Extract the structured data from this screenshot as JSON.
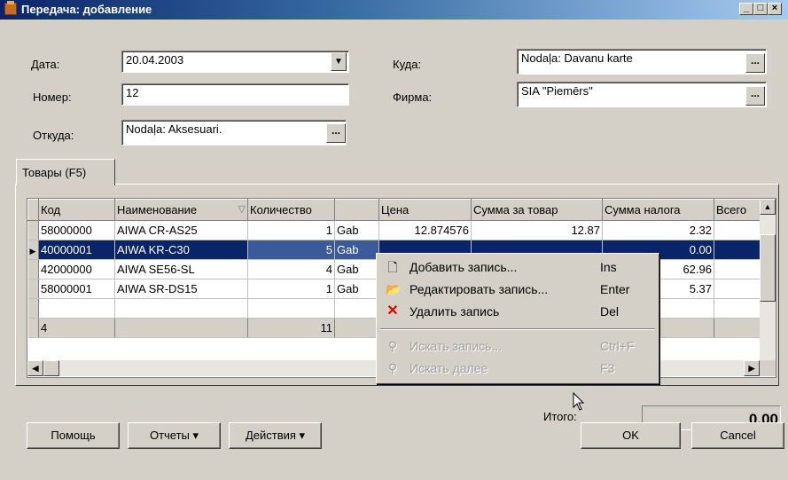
{
  "window": {
    "title": "Передача: добавление",
    "minimize": "_",
    "maximize": "□",
    "close": "×"
  },
  "form": {
    "date_label": "Дата:",
    "date_value": "20.04.2003",
    "number_label": "Номер:",
    "number_value": "12",
    "from_label": "Откуда:",
    "from_value": "Nodaļa: Aksesuari.",
    "to_label": "Куда:",
    "to_value": "Nodaļa: Davanu karte",
    "firm_label": "Фирма:",
    "firm_value": "SIA \"Piemērs\"",
    "ellipsis": "...",
    "dropdown": "▼"
  },
  "tab": {
    "label": "Товары (F5)"
  },
  "grid": {
    "columns": [
      "Код",
      "Наименование",
      "Количество",
      "",
      "Цена",
      "Сумма за товар",
      "Сумма налога",
      "Всего"
    ],
    "sort_glyph": "▽",
    "rows": [
      {
        "code": "58000000",
        "name": "AIWA CR-AS25",
        "qty": "1",
        "unit": "Gab",
        "price": "12.874576",
        "sum": "12.87",
        "tax": "2.32",
        "selected": false
      },
      {
        "code": "40000001",
        "name": "AIWA KR-C30",
        "qty": "5",
        "unit": "Gab",
        "price": "",
        "sum": "",
        "tax": "0.00",
        "selected": true
      },
      {
        "code": "42000000",
        "name": "AIWA SE56-SL",
        "qty": "4",
        "unit": "Gab",
        "price": "",
        "sum": "",
        "tax": "62.96",
        "selected": false
      },
      {
        "code": "58000001",
        "name": "AIWA SR-DS15",
        "qty": "1",
        "unit": "Gab",
        "price": "",
        "sum": "",
        "tax": "5.37",
        "selected": false
      }
    ],
    "footer": {
      "count": "4",
      "qty_total": "11"
    }
  },
  "context_menu": {
    "items": [
      {
        "label": "Добавить запись...",
        "shortcut": "Ins",
        "icon": "new-document-icon",
        "glyph": "🗋",
        "enabled": true
      },
      {
        "label": "Редактировать запись...",
        "shortcut": "Enter",
        "icon": "open-folder-icon",
        "glyph": "📂",
        "enabled": true
      },
      {
        "label": "Удалить запись",
        "shortcut": "Del",
        "icon": "delete-x-icon",
        "glyph": "✕",
        "enabled": true
      },
      {
        "label": "Искать запись...",
        "shortcut": "Ctrl+F",
        "icon": "binoculars-icon",
        "glyph": "⚲",
        "enabled": false
      },
      {
        "label": "Искать далее",
        "shortcut": "F3",
        "icon": "find-next-icon",
        "glyph": "⚲",
        "enabled": false
      }
    ]
  },
  "total": {
    "label": "Итого:",
    "value": "0.00"
  },
  "buttons": {
    "help": "Помощь",
    "reports": "Отчеты ▾",
    "actions": "Действия ▾",
    "ok": "OK",
    "cancel": "Cancel"
  },
  "colors": {
    "title_start": "#0a246a",
    "title_end": "#a6caf0",
    "selection": "#0a246a",
    "face": "#d4d0c8",
    "delete_icon": "#e00000",
    "folder_icon": "#e0a000"
  }
}
